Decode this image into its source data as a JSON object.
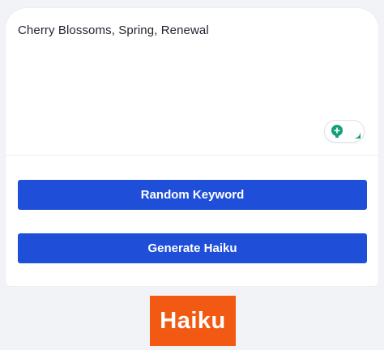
{
  "input": {
    "value": "Cherry Blossoms, Spring, Renewal"
  },
  "buttons": {
    "random_label": "Random Keyword",
    "generate_label": "Generate Haiku"
  },
  "brand": {
    "label": "Haiku"
  },
  "assistant_widget": {
    "icons": [
      "lightbulb-icon",
      "grammarly-icon"
    ]
  },
  "colors": {
    "primary_button": "#1f4fd8",
    "brand": "#f25a14",
    "widget_green": "#15a07a"
  }
}
